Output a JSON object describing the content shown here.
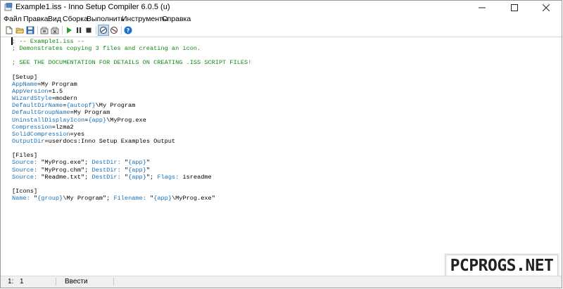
{
  "window": {
    "title": "Example1.iss - Inno Setup Compiler 6.0.5 (u)"
  },
  "menu": [
    {
      "label": "Файл"
    },
    {
      "label": "Правка"
    },
    {
      "label": "Вид"
    },
    {
      "label": "Сборка"
    },
    {
      "label": "Выполнить"
    },
    {
      "label": "Инструменты"
    },
    {
      "label": "Справка"
    }
  ],
  "toolbar": {
    "buttons": [
      {
        "icon": "new-file-icon"
      },
      {
        "icon": "open-folder-icon"
      },
      {
        "icon": "save-icon"
      },
      {
        "icon": "compile-icon"
      },
      {
        "icon": "stop-compile-icon"
      },
      {
        "icon": "run-icon"
      },
      {
        "icon": "pause-icon"
      },
      {
        "icon": "stop-icon"
      },
      {
        "icon": "target-setup-icon"
      },
      {
        "icon": "target-uninstall-icon"
      },
      {
        "icon": "help-icon"
      }
    ]
  },
  "editor": {
    "lines": [
      {
        "t": [
          {
            "c": "cm",
            "s": "; -- Example1.iss --"
          }
        ]
      },
      {
        "t": [
          {
            "c": "cm",
            "s": "; Demonstrates copying 3 files and creating an icon."
          }
        ]
      },
      {
        "t": []
      },
      {
        "t": [
          {
            "c": "cm",
            "s": "; SEE THE DOCUMENTATION FOR DETAILS ON CREATING .ISS SCRIPT FILES!"
          }
        ]
      },
      {
        "t": []
      },
      {
        "t": [
          {
            "c": "sec",
            "s": "[Setup]"
          }
        ]
      },
      {
        "t": [
          {
            "c": "key",
            "s": "AppName"
          },
          {
            "c": "sec",
            "s": "=My Program"
          }
        ]
      },
      {
        "t": [
          {
            "c": "key",
            "s": "AppVersion"
          },
          {
            "c": "sec",
            "s": "=1.5"
          }
        ]
      },
      {
        "t": [
          {
            "c": "key",
            "s": "WizardStyle"
          },
          {
            "c": "sec",
            "s": "=modern"
          }
        ]
      },
      {
        "t": [
          {
            "c": "key",
            "s": "DefaultDirName"
          },
          {
            "c": "sec",
            "s": "="
          },
          {
            "c": "cst",
            "s": "{autopf}"
          },
          {
            "c": "sec",
            "s": "\\My Program"
          }
        ]
      },
      {
        "t": [
          {
            "c": "key",
            "s": "DefaultGroupName"
          },
          {
            "c": "sec",
            "s": "=My Program"
          }
        ]
      },
      {
        "t": [
          {
            "c": "key",
            "s": "UninstallDisplayIcon"
          },
          {
            "c": "sec",
            "s": "="
          },
          {
            "c": "cst",
            "s": "{app}"
          },
          {
            "c": "sec",
            "s": "\\MyProg.exe"
          }
        ]
      },
      {
        "t": [
          {
            "c": "key",
            "s": "Compression"
          },
          {
            "c": "sec",
            "s": "=lzma2"
          }
        ]
      },
      {
        "t": [
          {
            "c": "key",
            "s": "SolidCompression"
          },
          {
            "c": "sec",
            "s": "=yes"
          }
        ]
      },
      {
        "t": [
          {
            "c": "key",
            "s": "OutputDir"
          },
          {
            "c": "sec",
            "s": "=userdocs:Inno Setup Examples Output"
          }
        ]
      },
      {
        "t": []
      },
      {
        "t": [
          {
            "c": "sec",
            "s": "[Files]"
          }
        ]
      },
      {
        "t": [
          {
            "c": "par",
            "s": "Source:"
          },
          {
            "c": "sec",
            "s": " \"MyProg.exe\"; "
          },
          {
            "c": "par",
            "s": "DestDir:"
          },
          {
            "c": "sec",
            "s": " \""
          },
          {
            "c": "cst",
            "s": "{app}"
          },
          {
            "c": "sec",
            "s": "\""
          }
        ]
      },
      {
        "t": [
          {
            "c": "par",
            "s": "Source:"
          },
          {
            "c": "sec",
            "s": " \"MyProg.chm\"; "
          },
          {
            "c": "par",
            "s": "DestDir:"
          },
          {
            "c": "sec",
            "s": " \""
          },
          {
            "c": "cst",
            "s": "{app}"
          },
          {
            "c": "sec",
            "s": "\""
          }
        ]
      },
      {
        "t": [
          {
            "c": "par",
            "s": "Source:"
          },
          {
            "c": "sec",
            "s": " \"Readme.txt\"; "
          },
          {
            "c": "par",
            "s": "DestDir:"
          },
          {
            "c": "sec",
            "s": " \""
          },
          {
            "c": "cst",
            "s": "{app}"
          },
          {
            "c": "sec",
            "s": "\"; "
          },
          {
            "c": "par",
            "s": "Flags:"
          },
          {
            "c": "sec",
            "s": " isreadme"
          }
        ]
      },
      {
        "t": []
      },
      {
        "t": [
          {
            "c": "sec",
            "s": "[Icons]"
          }
        ]
      },
      {
        "t": [
          {
            "c": "par",
            "s": "Name:"
          },
          {
            "c": "sec",
            "s": " \""
          },
          {
            "c": "cst",
            "s": "{group}"
          },
          {
            "c": "sec",
            "s": "\\My Program\"; "
          },
          {
            "c": "par",
            "s": "Filename:"
          },
          {
            "c": "sec",
            "s": " \""
          },
          {
            "c": "cst",
            "s": "{app}"
          },
          {
            "c": "sec",
            "s": "\\MyProg.exe\""
          }
        ]
      }
    ]
  },
  "status": {
    "line": "1:",
    "col": "1",
    "mode": "Ввести"
  },
  "watermark": "PCPROGS.NET",
  "colors": {
    "comment": "#148a14",
    "keyword": "#1c6fb3",
    "help": "#1a73c9"
  }
}
